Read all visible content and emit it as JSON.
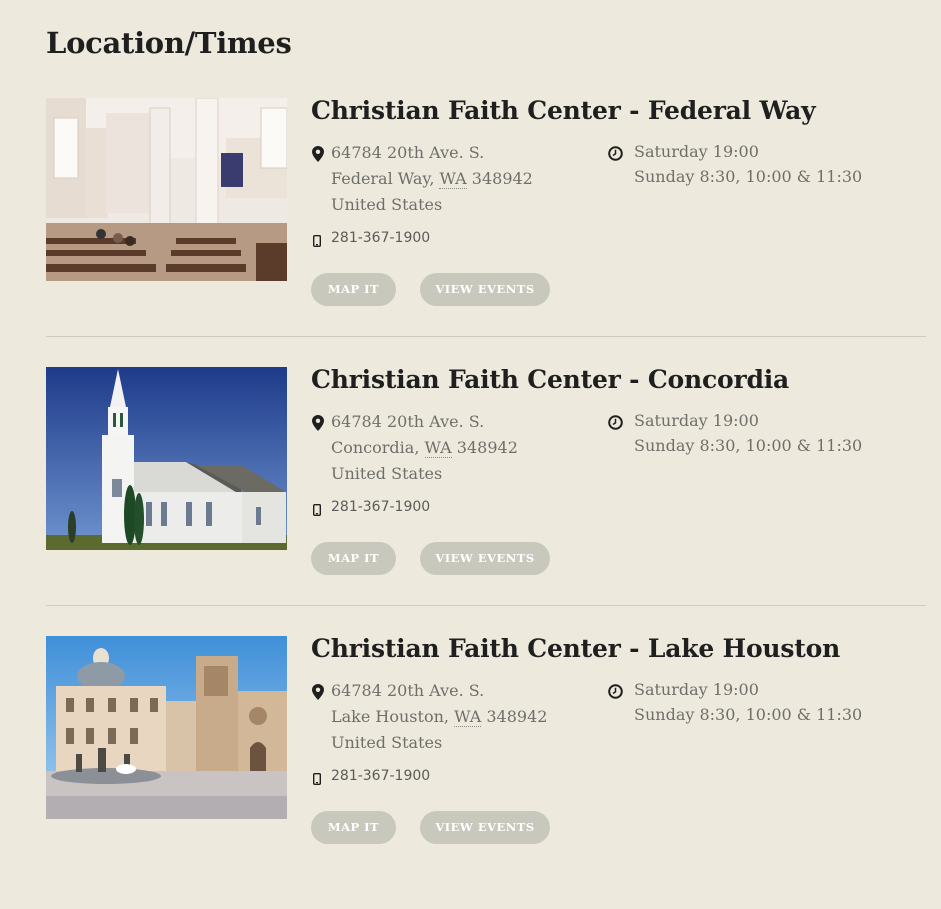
{
  "page": {
    "title": "Location/Times"
  },
  "buttons": {
    "map": "MAP IT",
    "events": "VIEW EVENTS"
  },
  "locations": [
    {
      "name": "Christian Faith Center - Federal Way",
      "image": "church-interior",
      "address": {
        "street": "64784 20th Ave. S.",
        "city": "Federal Way",
        "state": "WA",
        "zip": "348942",
        "country": "United States"
      },
      "phone": "281-367-1900",
      "times": [
        "Saturday 19:00",
        "Sunday 8:30, 10:00 & 11:30"
      ]
    },
    {
      "name": "Christian Faith Center - Concordia",
      "image": "white-church-exterior",
      "address": {
        "street": "64784 20th Ave. S.",
        "city": "Concordia",
        "state": "WA",
        "zip": "348942",
        "country": "United States"
      },
      "phone": "281-367-1900",
      "times": [
        "Saturday 19:00",
        "Sunday 8:30, 10:00 & 11:30"
      ]
    },
    {
      "name": "Christian Faith Center - Lake Houston",
      "image": "cathedral-plaza",
      "address": {
        "street": "64784 20th Ave. S.",
        "city": "Lake Houston",
        "state": "WA",
        "zip": "348942",
        "country": "United States"
      },
      "phone": "281-367-1900",
      "times": [
        "Saturday 19:00",
        "Sunday 8:30, 10:00 & 11:30"
      ]
    }
  ],
  "colors": {
    "background": "#edeadd",
    "button": "#c9c8bd",
    "heading": "#1f1f1f",
    "muted_text": "#6f6f6a"
  }
}
